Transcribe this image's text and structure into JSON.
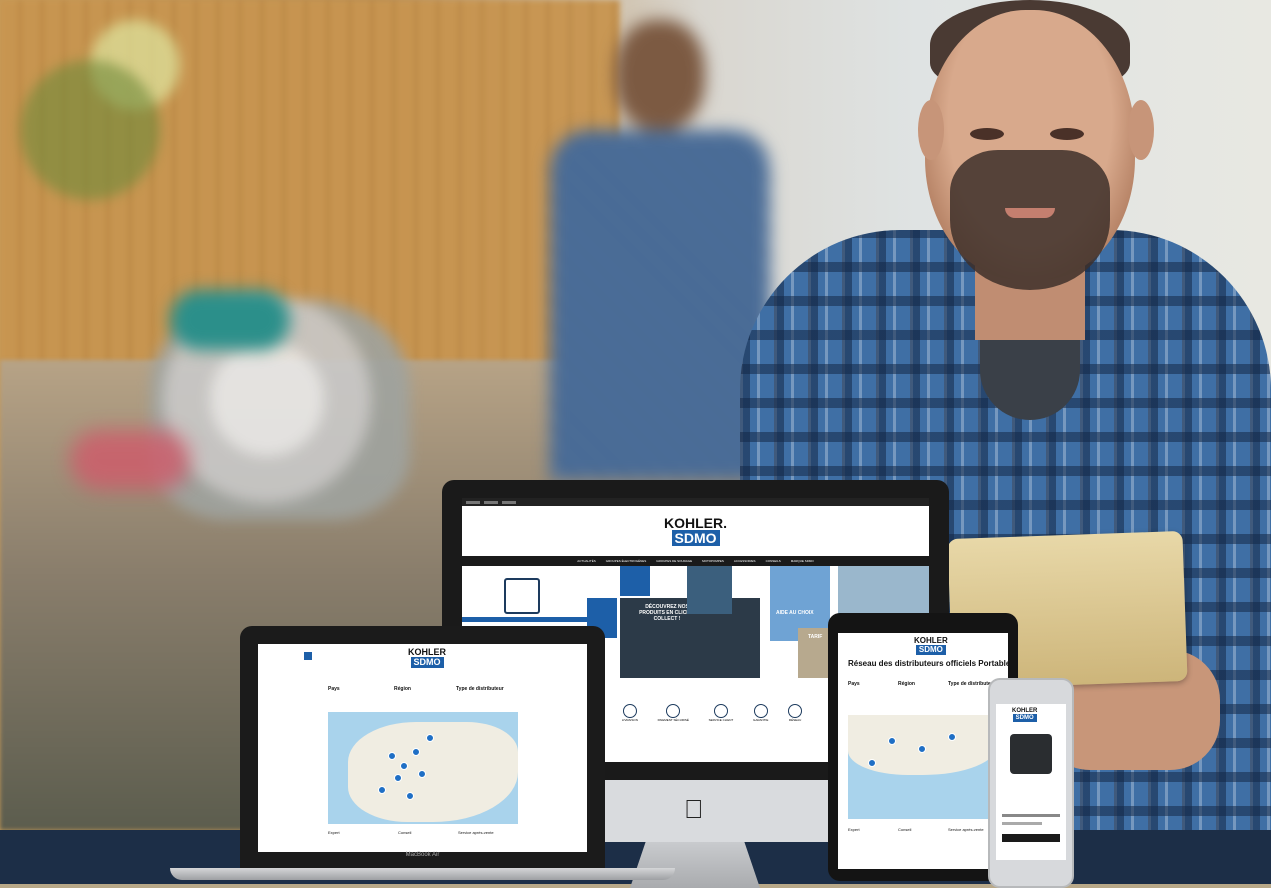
{
  "imac_site": {
    "brand_top": "KOHLER.",
    "brand_bottom": "SDMO",
    "nav_items": [
      "ACTUALITÉS",
      "GROUPES ÉLECTROGÈNES",
      "GROUPES DE SOUDAGE",
      "MOTOPOMPES",
      "ACCESSOIRES",
      "CONSEILS",
      "MARQUE SDMO"
    ],
    "promo_text": "DÉCOUVREZ NOS PRODUITS EN CLICK & COLLECT !",
    "help_text": "AIDE AU CHOIX",
    "tarif_text": "TARIF",
    "feature_labels": [
      "LIVRAISON",
      "PAIEMENT SÉCURISÉ",
      "SERVICE CLIENT",
      "GARANTIE",
      "RÉSEAU"
    ]
  },
  "macbook_site": {
    "brand_top": "KOHLER",
    "brand_bottom": "SDMO",
    "filter_labels": [
      "Pays",
      "Région",
      "Type de distributeur"
    ],
    "legend_items": [
      "Expert",
      "Conseil",
      "Service après-vente"
    ],
    "device_label": "MacBook Air"
  },
  "tablet_site": {
    "brand_top": "KOHLER",
    "brand_bottom": "SDMO",
    "heading": "Réseau des distributeurs officiels Portable Power",
    "filter_labels": [
      "Pays",
      "Région",
      "Type de distributeur"
    ],
    "legend_items": [
      "Expert",
      "Conseil",
      "Service après-vente"
    ]
  },
  "phone_site": {
    "brand_top": "KOHLER",
    "brand_bottom": "SDMO"
  },
  "colors": {
    "brand_blue": "#1d5fa8",
    "navy_floor": "#1c2e47",
    "map_water": "#a9d3ec",
    "pin_blue": "#1f6fc5"
  }
}
